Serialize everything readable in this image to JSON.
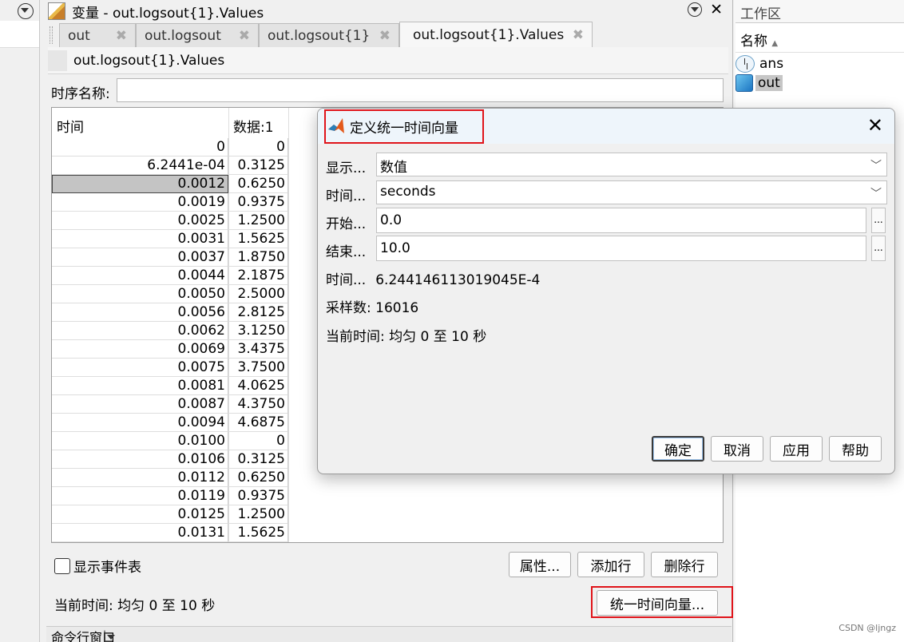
{
  "editor": {
    "title": "变量 - out.logsout{1}.Values",
    "tabs": [
      {
        "label": "out",
        "close": "✖"
      },
      {
        "label": "out.logsout",
        "close": "✖"
      },
      {
        "label": "out.logsout{1}",
        "close": "✖"
      },
      {
        "label": "out.logsout{1}.Values",
        "close": "✖"
      }
    ],
    "path": "out.logsout{1}.Values",
    "timeseries_name_label": "时序名称:",
    "timeseries_name_value": "",
    "table": {
      "headers": [
        "时间",
        "数据:1"
      ],
      "rows": [
        [
          "0",
          "0"
        ],
        [
          "6.2441e-04",
          "0.3125"
        ],
        [
          "0.0012",
          "0.6250"
        ],
        [
          "0.0019",
          "0.9375"
        ],
        [
          "0.0025",
          "1.2500"
        ],
        [
          "0.0031",
          "1.5625"
        ],
        [
          "0.0037",
          "1.8750"
        ],
        [
          "0.0044",
          "2.1875"
        ],
        [
          "0.0050",
          "2.5000"
        ],
        [
          "0.0056",
          "2.8125"
        ],
        [
          "0.0062",
          "3.1250"
        ],
        [
          "0.0069",
          "3.4375"
        ],
        [
          "0.0075",
          "3.7500"
        ],
        [
          "0.0081",
          "4.0625"
        ],
        [
          "0.0087",
          "4.3750"
        ],
        [
          "0.0094",
          "4.6875"
        ],
        [
          "0.0100",
          "0"
        ],
        [
          "0.0106",
          "0.3125"
        ],
        [
          "0.0112",
          "0.6250"
        ],
        [
          "0.0119",
          "0.9375"
        ],
        [
          "0.0125",
          "1.2500"
        ],
        [
          "0.0131",
          "1.5625"
        ]
      ],
      "selected_row": 2
    },
    "show_events_label": "显示事件表",
    "buttons": {
      "properties": "属性...",
      "add_row": "添加行",
      "delete_row": "删除行",
      "uniform_time": "统一时间向量..."
    },
    "current_time": "当前时间: 均匀 0 至 10 秒",
    "command_window": "命令行窗口"
  },
  "workspace": {
    "title": "工作区",
    "column_name": "名称",
    "sort_arrow": "▲",
    "items": [
      {
        "label": "ans",
        "icon": "ans-icon"
      },
      {
        "label": "out",
        "icon": "struct-icon"
      }
    ]
  },
  "dialog": {
    "title": "定义统一时间向量",
    "close": "✕",
    "display_label": "显示...",
    "display_value": "数值",
    "time_units_label": "时间...",
    "time_units_value": "seconds",
    "start_label": "开始...",
    "start_value": "0.0",
    "end_label": "结束...",
    "end_value": "10.0",
    "ellipsis": "...",
    "interval_label": "时间...",
    "interval_value": "6.244146113019045E-4",
    "samples_label": "采样数:",
    "samples_value": "16016",
    "current_time": "当前时间: 均匀 0 至 10 秒",
    "buttons": {
      "ok": "确定",
      "cancel": "取消",
      "apply": "应用",
      "help": "帮助"
    }
  },
  "watermark": "CSDN @ljngz",
  "colors": {
    "highlight_box": "#e0141a",
    "selected_row": "#c4c4c4"
  }
}
